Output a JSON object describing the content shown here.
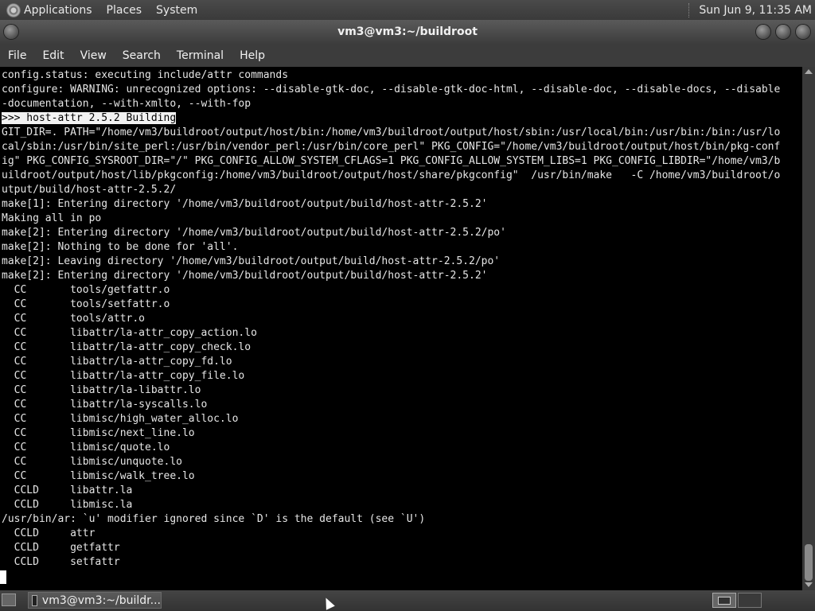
{
  "top_panel": {
    "menus": [
      "Applications",
      "Places",
      "System"
    ],
    "clock": "Sun Jun  9, 11:35 AM"
  },
  "window": {
    "title": "vm3@vm3:~/buildroot"
  },
  "menubar": {
    "items": [
      "File",
      "Edit",
      "View",
      "Search",
      "Terminal",
      "Help"
    ]
  },
  "terminal": {
    "lines": [
      "config.status: executing include/attr commands",
      "configure: WARNING: unrecognized options: --disable-gtk-doc, --disable-gtk-doc-html, --disable-doc, --disable-docs, --disable",
      "-documentation, --with-xmlto, --with-fop",
      ">>> host-attr 2.5.2 Building",
      "GIT_DIR=. PATH=\"/home/vm3/buildroot/output/host/bin:/home/vm3/buildroot/output/host/sbin:/usr/local/bin:/usr/bin:/bin:/usr/lo",
      "cal/sbin:/usr/bin/site_perl:/usr/bin/vendor_perl:/usr/bin/core_perl\" PKG_CONFIG=\"/home/vm3/buildroot/output/host/bin/pkg-conf",
      "ig\" PKG_CONFIG_SYSROOT_DIR=\"/\" PKG_CONFIG_ALLOW_SYSTEM_CFLAGS=1 PKG_CONFIG_ALLOW_SYSTEM_LIBS=1 PKG_CONFIG_LIBDIR=\"/home/vm3/b",
      "uildroot/output/host/lib/pkgconfig:/home/vm3/buildroot/output/host/share/pkgconfig\"  /usr/bin/make   -C /home/vm3/buildroot/o",
      "utput/build/host-attr-2.5.2/",
      "make[1]: Entering directory '/home/vm3/buildroot/output/build/host-attr-2.5.2'",
      "Making all in po",
      "make[2]: Entering directory '/home/vm3/buildroot/output/build/host-attr-2.5.2/po'",
      "make[2]: Nothing to be done for 'all'.",
      "make[2]: Leaving directory '/home/vm3/buildroot/output/build/host-attr-2.5.2/po'",
      "make[2]: Entering directory '/home/vm3/buildroot/output/build/host-attr-2.5.2'",
      "  CC       tools/getfattr.o",
      "  CC       tools/setfattr.o",
      "  CC       tools/attr.o",
      "  CC       libattr/la-attr_copy_action.lo",
      "  CC       libattr/la-attr_copy_check.lo",
      "  CC       libattr/la-attr_copy_fd.lo",
      "  CC       libattr/la-attr_copy_file.lo",
      "  CC       libattr/la-libattr.lo",
      "  CC       libattr/la-syscalls.lo",
      "  CC       libmisc/high_water_alloc.lo",
      "  CC       libmisc/next_line.lo",
      "  CC       libmisc/quote.lo",
      "  CC       libmisc/unquote.lo",
      "  CC       libmisc/walk_tree.lo",
      "  CCLD     libattr.la",
      "  CCLD     libmisc.la",
      "/usr/bin/ar: `u' modifier ignored since `D' is the default (see `U')",
      "  CCLD     attr",
      "  CCLD     getfattr",
      "  CCLD     setfattr"
    ],
    "highlight_index": 3
  },
  "taskbar": {
    "entry_label": "vm3@vm3:~/buildr..."
  }
}
